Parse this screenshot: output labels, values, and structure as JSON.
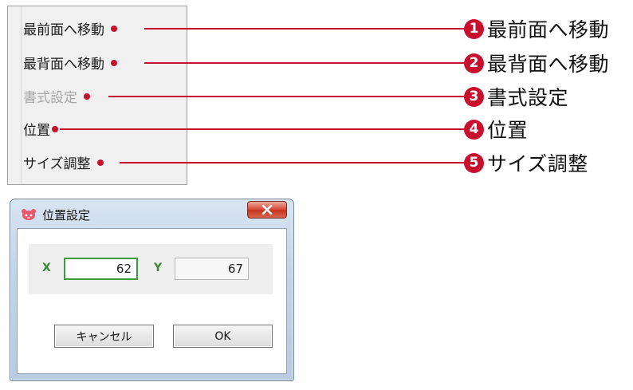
{
  "menu": {
    "items": [
      {
        "label": "最前面へ移動",
        "enabled": true
      },
      {
        "label": "最背面へ移動",
        "enabled": true
      },
      {
        "label": "書式設定",
        "enabled": false
      },
      {
        "label": "位置",
        "enabled": true
      },
      {
        "label": "サイズ調整",
        "enabled": true
      }
    ]
  },
  "callouts": [
    {
      "number": "1",
      "text": "最前面へ移動"
    },
    {
      "number": "2",
      "text": "最背面へ移動"
    },
    {
      "number": "3",
      "text": "書式設定"
    },
    {
      "number": "4",
      "text": "位置"
    },
    {
      "number": "5",
      "text": "サイズ調整"
    }
  ],
  "dialog": {
    "title": "位置設定",
    "close_glyph": "X",
    "x_label": "X",
    "x_value": "62",
    "y_label": "Y",
    "y_value": "67",
    "cancel_label": "キャンセル",
    "ok_label": "OK"
  },
  "colors": {
    "accent": "#c8102e",
    "field_focus": "#3d9b3d",
    "axis_label": "#3b8a3b"
  }
}
